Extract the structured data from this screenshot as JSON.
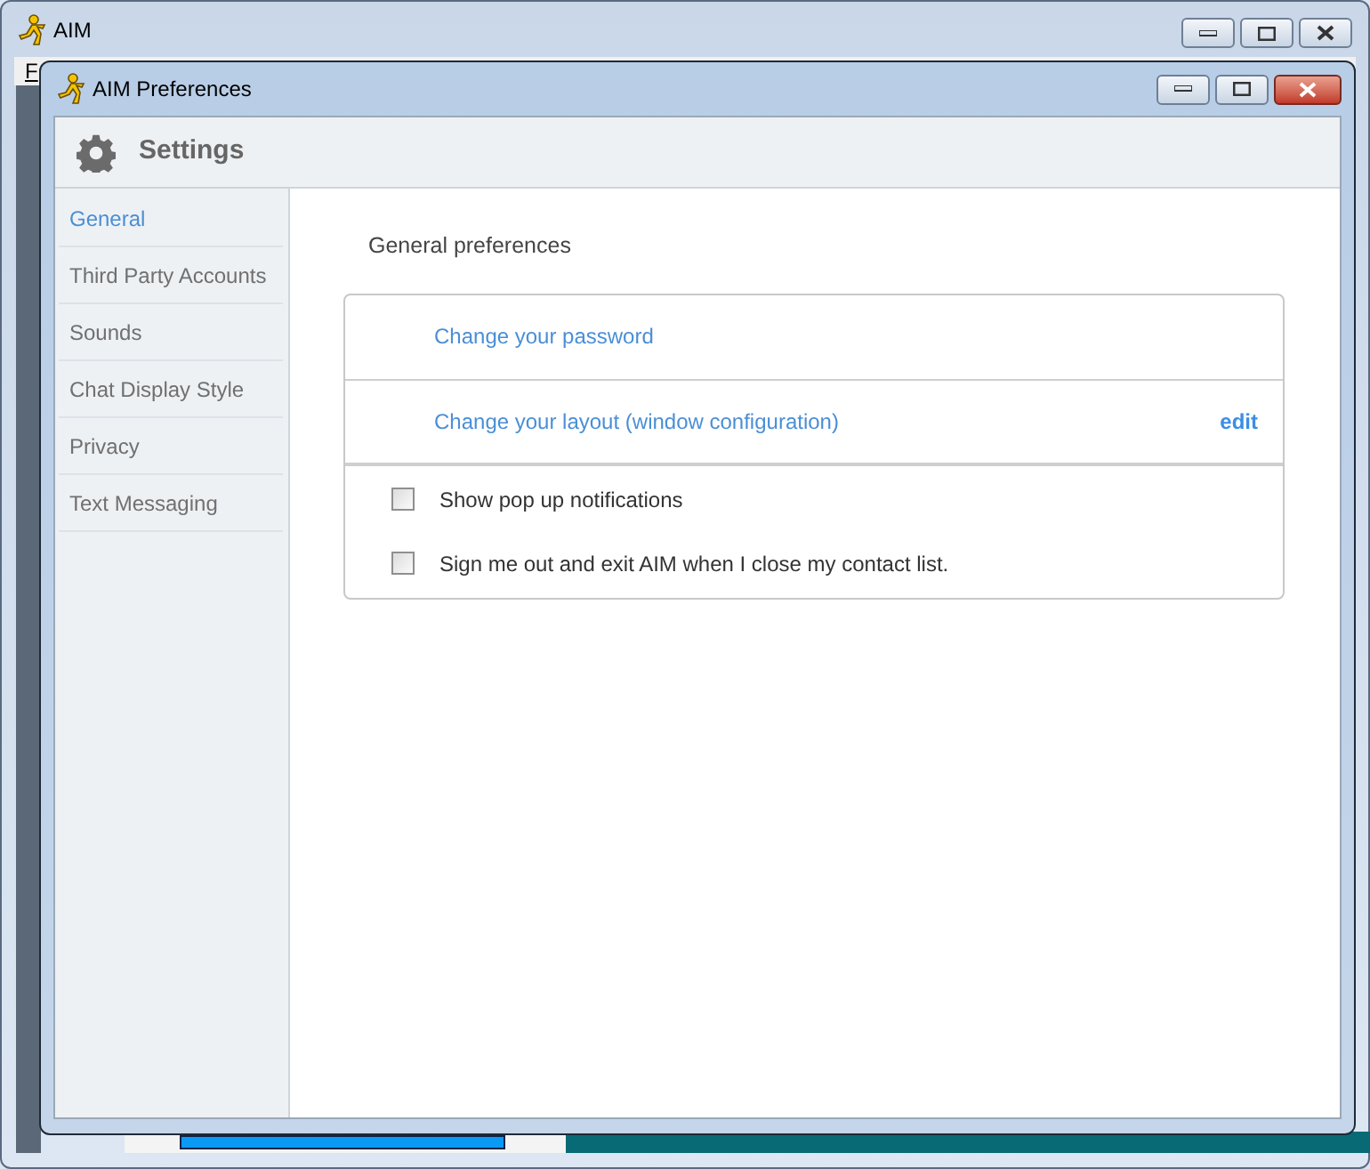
{
  "main_window": {
    "title": "AIM",
    "menu": [
      "F"
    ]
  },
  "window": {
    "title": "AIM Preferences"
  },
  "header": {
    "title": "Settings"
  },
  "sidebar": {
    "items": [
      {
        "label": "General",
        "selected": true
      },
      {
        "label": "Third Party Accounts",
        "selected": false
      },
      {
        "label": "Sounds",
        "selected": false
      },
      {
        "label": "Chat Display Style",
        "selected": false
      },
      {
        "label": "Privacy",
        "selected": false
      },
      {
        "label": "Text Messaging",
        "selected": false
      }
    ]
  },
  "section_title": "General preferences",
  "rows": [
    {
      "kind": "link",
      "label": "Change your password"
    },
    {
      "kind": "link",
      "label": "Change your layout (window configuration)",
      "action": "edit"
    }
  ],
  "options": [
    {
      "label": "Show pop up notifications",
      "checked": false
    },
    {
      "label": "Sign me out and exit AIM when I close my contact list.",
      "checked": false
    }
  ]
}
